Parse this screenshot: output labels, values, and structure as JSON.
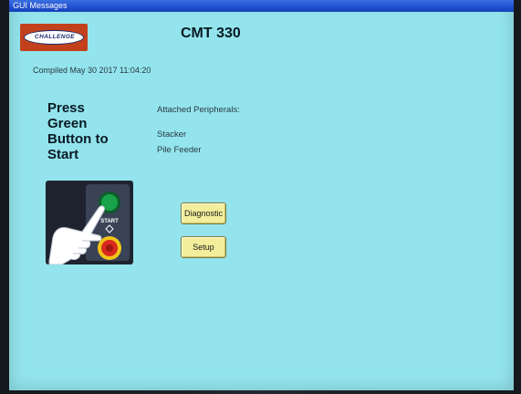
{
  "window": {
    "title": "GUI Messages"
  },
  "header": {
    "logo_text": "CHALLENGE",
    "model": "CMT 330"
  },
  "compiled": "Compiled May 30 2017 11:04:20",
  "instruction": {
    "lines": [
      "Press",
      "Green",
      "Button to",
      "Start"
    ]
  },
  "peripherals": {
    "heading": "Attached Peripherals:",
    "items": [
      "Stacker",
      "Pile Feeder"
    ]
  },
  "illustration": {
    "start_label": "START",
    "colors": {
      "panel": "#1f2330",
      "start_button": "#1aa34a",
      "stop_button": "#d9281e",
      "stop_ring": "#f2c418"
    }
  },
  "buttons": {
    "diagnostic": "Diagnostic",
    "setup": "Setup"
  },
  "colors": {
    "screen_background": "#93e4ec",
    "titlebar": "#1f4fd0",
    "button_fill": "#f3ee9b",
    "logo_background": "#c2411c"
  }
}
